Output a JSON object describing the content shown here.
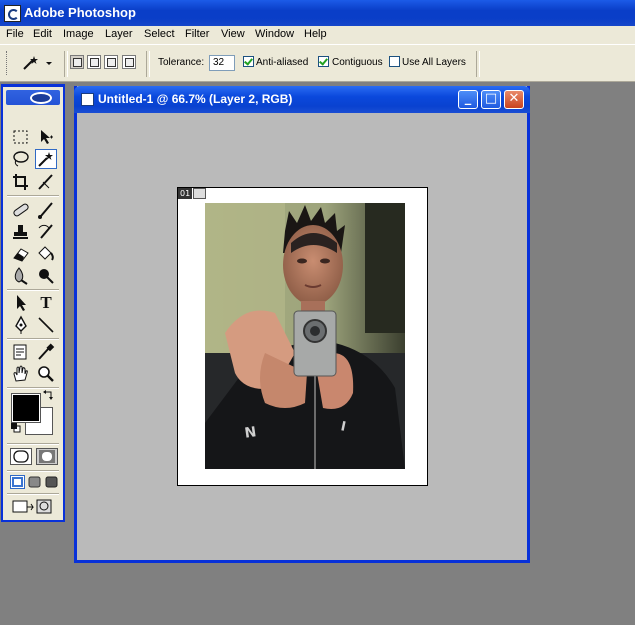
{
  "app": {
    "title": "Adobe Photoshop"
  },
  "menu": [
    "File",
    "Edit",
    "Image",
    "Layer",
    "Select",
    "Filter",
    "View",
    "Window",
    "Help"
  ],
  "options": {
    "tolerance_label": "Tolerance:",
    "tolerance_value": "32",
    "anti_aliased": {
      "label": "Anti-aliased",
      "checked": true
    },
    "contiguous": {
      "label": "Contiguous",
      "checked": true
    },
    "use_all_layers": {
      "label": "Use All Layers",
      "checked": false
    }
  },
  "document": {
    "title": "Untitled-1 @ 66.7% (Layer 2, RGB)",
    "slice_number": "01",
    "controls": {
      "minimize": "_",
      "maximize": "□",
      "close": "✕"
    }
  },
  "colors": {
    "foreground": "#000000",
    "background": "#ffffff",
    "title_bar": "#0a3ec8",
    "canvas_area": "#bababa"
  }
}
